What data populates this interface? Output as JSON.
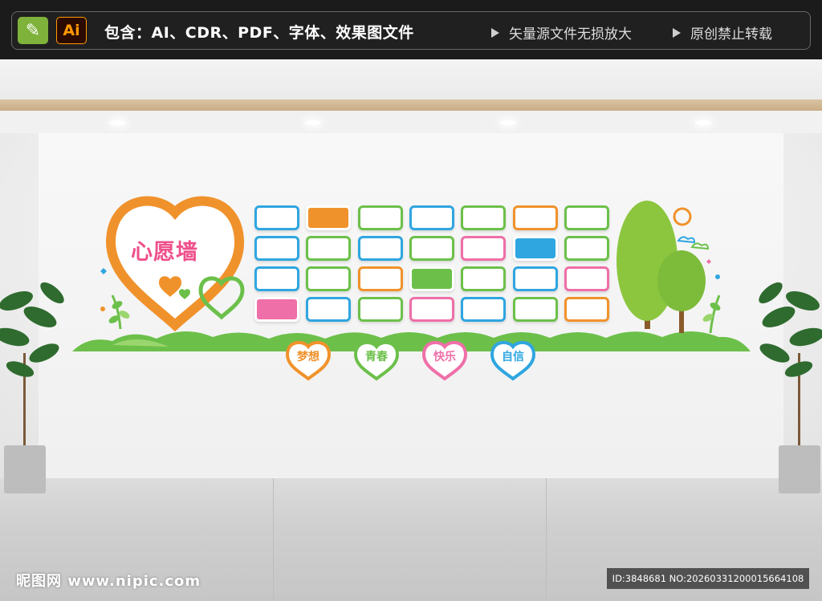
{
  "banner": {
    "pen_icon": "pencil-icon",
    "ai_label": "Ai",
    "includes": "包含：AI、CDR、PDF、字体、效果图文件",
    "feature1": "矢量源文件无损放大",
    "feature2": "原创禁止转载"
  },
  "wall": {
    "title": "心愿墙",
    "hearts": [
      {
        "label": "梦想",
        "color": "#f0922b"
      },
      {
        "label": "青春",
        "color": "#6cc04a"
      },
      {
        "label": "快乐",
        "color": "#ef6fa8"
      },
      {
        "label": "自信",
        "color": "#2fa6e0"
      }
    ],
    "card_colors": [
      "#2fa6e0",
      "#f0922b",
      "#6cc04a",
      "#ef6fa8"
    ]
  },
  "footer": {
    "watermark": "昵图网 www.nipic.com",
    "id_text": "ID:3848681 NO:20260331200015664108"
  }
}
